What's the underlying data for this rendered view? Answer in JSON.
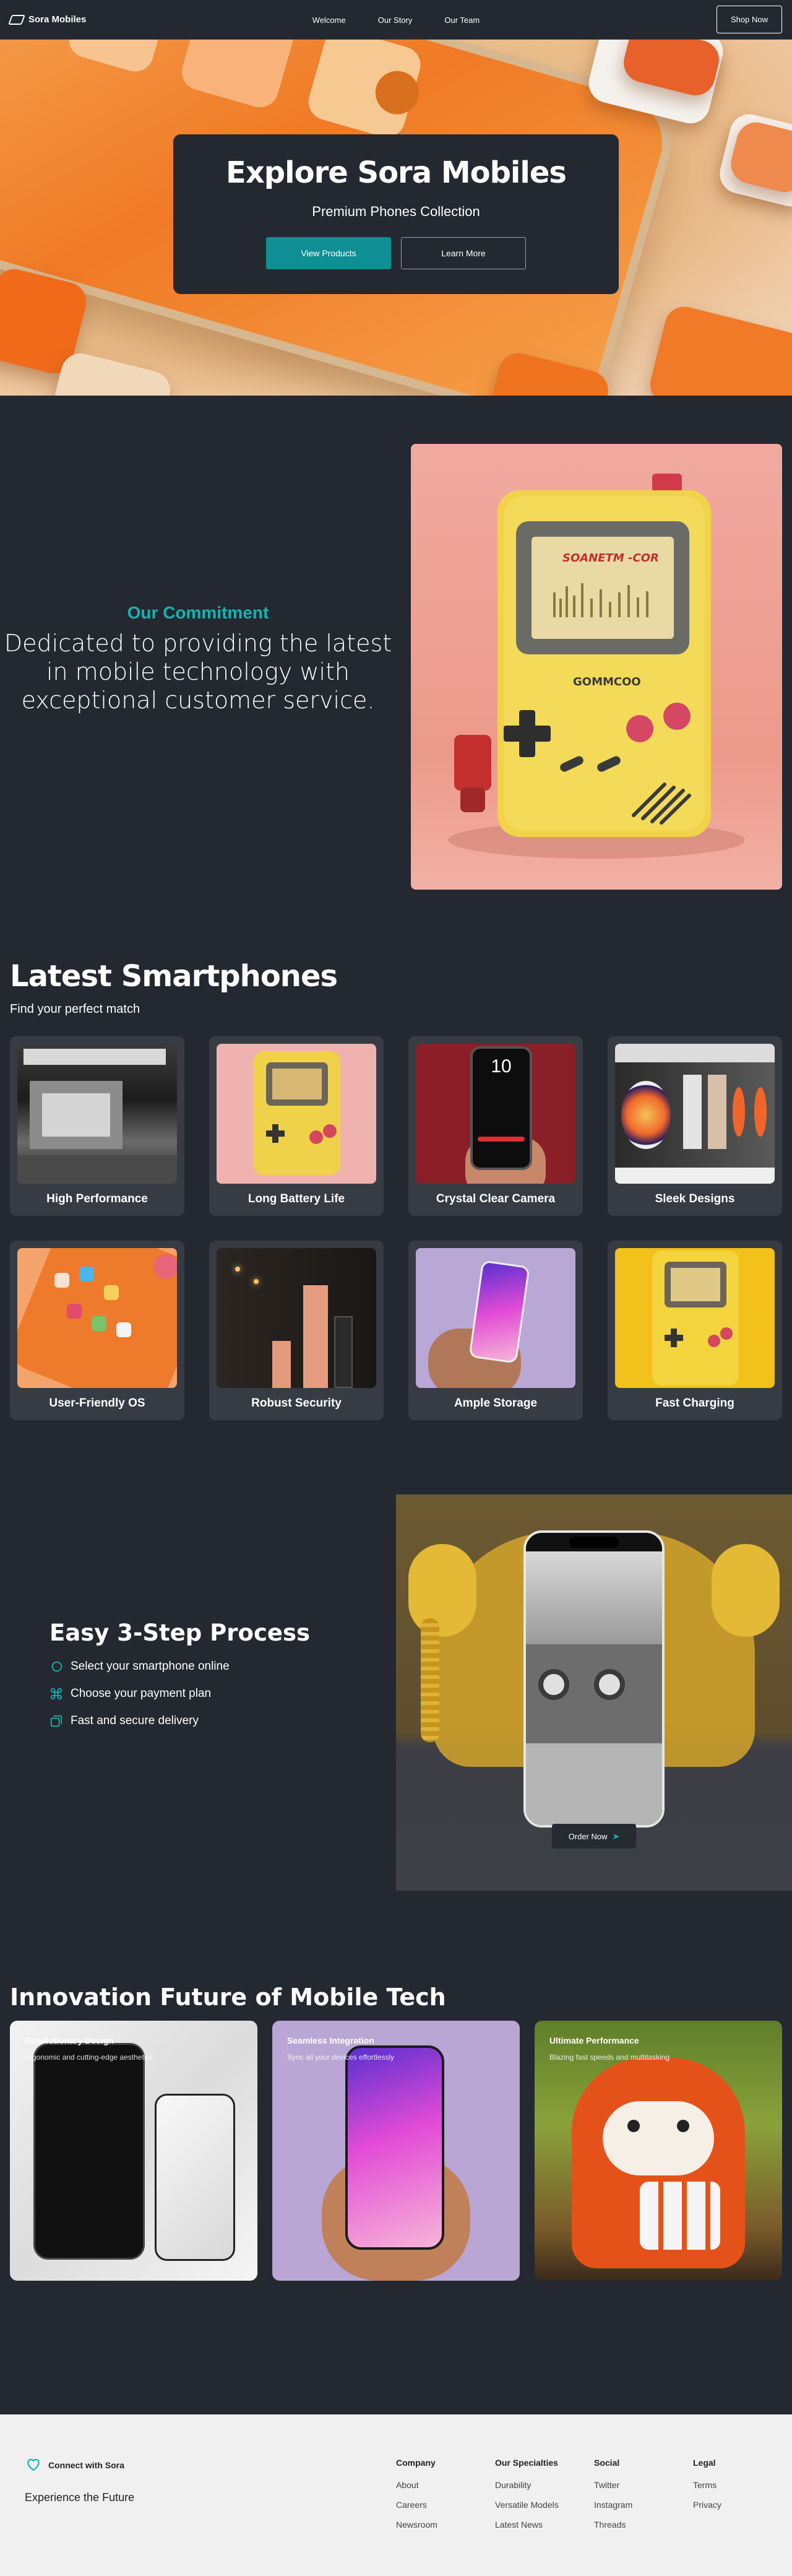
{
  "nav": {
    "brand": "Sora Mobiles",
    "links": [
      "Welcome",
      "Our Story",
      "Our Team"
    ],
    "cta": "Shop Now"
  },
  "hero": {
    "title": "Explore Sora Mobiles",
    "subtitle": "Premium Phones Collection",
    "primary_button": "View Products",
    "secondary_button": "Learn More"
  },
  "commitment": {
    "kicker": "Our Commitment",
    "body": "Dedicated to providing the latest in mobile technology with exceptional customer service.",
    "image_screen_text": "SOANETM -COR",
    "image_brand_text": "GOMMCOO"
  },
  "latest": {
    "title": "Latest Smartphones",
    "subtitle": "Find your perfect match",
    "products": [
      {
        "label": "High Performance",
        "theme": "store-bw"
      },
      {
        "label": "Long Battery Life",
        "theme": "yellow-handheld-pink"
      },
      {
        "label": "Crystal Clear Camera",
        "theme": "hand-phone-red"
      },
      {
        "label": "Sleek Designs",
        "theme": "windows-orange"
      },
      {
        "label": "User-Friendly OS",
        "theme": "orange-phone-apps"
      },
      {
        "label": "Robust Security",
        "theme": "dark-room-pink"
      },
      {
        "label": "Ample Storage",
        "theme": "hand-phone-lavender"
      },
      {
        "label": "Fast Charging",
        "theme": "yellow-handheld-yellow"
      }
    ],
    "camera_screen_time": "10"
  },
  "process": {
    "title": "Easy 3-Step Process",
    "steps": [
      {
        "label": "Select your smartphone online",
        "icon": "chat-icon"
      },
      {
        "label": "Choose your payment plan",
        "icon": "command-icon"
      },
      {
        "label": "Fast and secure delivery",
        "icon": "box-icon"
      }
    ],
    "order_button": "Order Now"
  },
  "innovation": {
    "title_part1": "Innovation",
    "title_part2": "Future of Mobile Tech",
    "cards": [
      {
        "title": "Revolutionary Design",
        "desc": "Ergonomic and cutting-edge aesthetics",
        "theme": "marble"
      },
      {
        "title": "Seamless Integration",
        "desc": "Sync all your devices effortlessly",
        "theme": "lavender"
      },
      {
        "title": "Ultimate Performance",
        "desc": "Blazing fast speeds and multitasking",
        "theme": "red-panda"
      }
    ]
  },
  "footer": {
    "brand": "Connect with Sora",
    "tagline": "Experience the Future",
    "columns": [
      {
        "heading": "Company",
        "links": [
          "About",
          "Careers",
          "Newsroom"
        ]
      },
      {
        "heading": "Our Specialties",
        "links": [
          "Durability",
          "Versatile Models",
          "Latest News"
        ]
      },
      {
        "heading": "Social",
        "links": [
          "Twitter",
          "Instagram",
          "Threads"
        ]
      },
      {
        "heading": "Legal",
        "links": [
          "Terms",
          "Privacy"
        ]
      }
    ]
  },
  "colors": {
    "background": "#242830",
    "accent": "#0e8f93",
    "accent_text": "#16b3b3",
    "card": "#373b44",
    "footer": "#f0f0f0"
  }
}
